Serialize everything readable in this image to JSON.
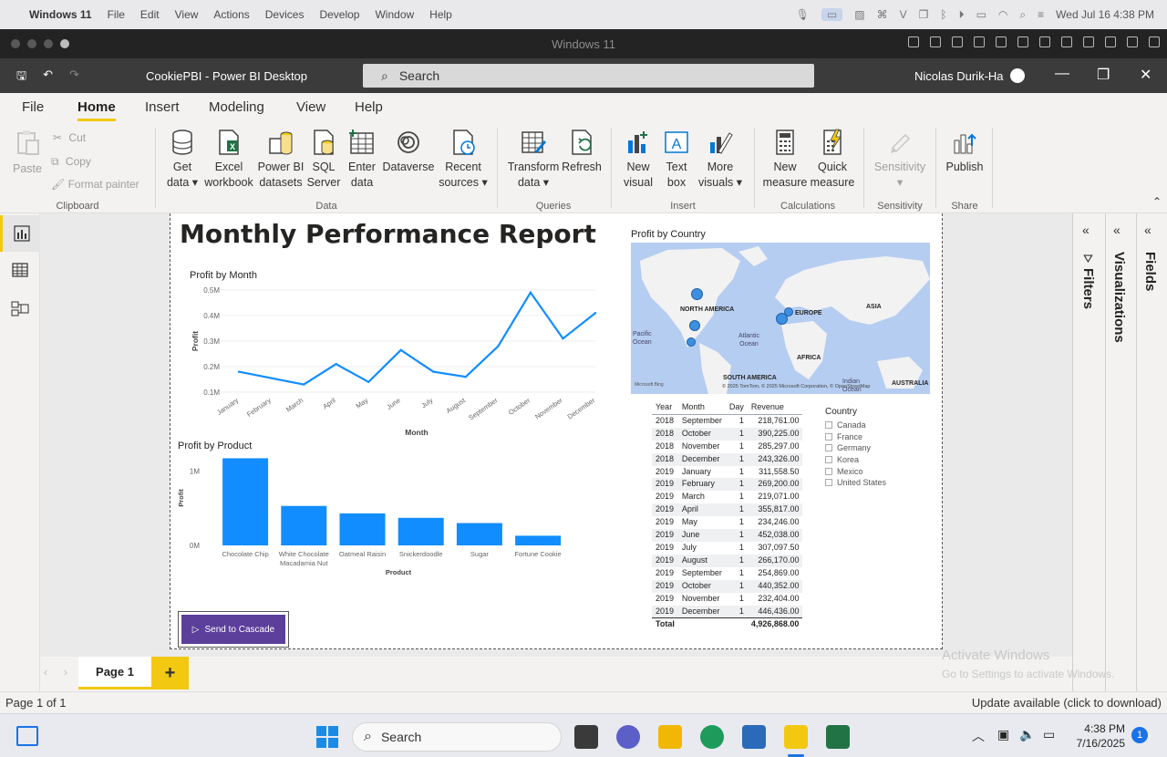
{
  "mac": {
    "menu": [
      "Windows 11",
      "File",
      "Edit",
      "View",
      "Actions",
      "Devices",
      "Develop",
      "Window",
      "Help"
    ],
    "datetime": "Wed Jul 16  4:38 PM"
  },
  "vm": {
    "title": "Windows 11"
  },
  "app": {
    "title": "CookiePBI - Power BI Desktop",
    "search_placeholder": "Search",
    "user": "Nicolas Durik-Ha"
  },
  "tabs": [
    "File",
    "Home",
    "Insert",
    "Modeling",
    "View",
    "Help"
  ],
  "ribbon": {
    "clipboard": {
      "paste": "Paste",
      "cut": "Cut",
      "copy": "Copy",
      "format_painter": "Format painter",
      "group": "Clipboard"
    },
    "data": {
      "get_data": [
        "Get",
        "data"
      ],
      "excel": [
        "Excel",
        "workbook"
      ],
      "pbi_datasets": [
        "Power BI",
        "datasets"
      ],
      "sql": [
        "SQL",
        "Server"
      ],
      "enter": [
        "Enter",
        "data"
      ],
      "dataverse": [
        "Dataverse",
        ""
      ],
      "recent": [
        "Recent",
        "sources"
      ],
      "group": "Data"
    },
    "queries": {
      "transform": [
        "Transform",
        "data"
      ],
      "refresh": [
        "Refresh",
        ""
      ],
      "group": "Queries"
    },
    "insert": {
      "new_visual": [
        "New",
        "visual"
      ],
      "text_box": [
        "Text",
        "box"
      ],
      "more_visuals": [
        "More",
        "visuals"
      ],
      "group": "Insert"
    },
    "calculations": {
      "new_measure": [
        "New",
        "measure"
      ],
      "quick_measure": [
        "Quick",
        "measure"
      ],
      "group": "Calculations"
    },
    "sensitivity": {
      "label": "Sensitivity",
      "group": "Sensitivity"
    },
    "share": {
      "publish": "Publish",
      "group": "Share"
    }
  },
  "report": {
    "title": "Monthly Performance Report",
    "send_button": "Send to Cascade",
    "map_title": "Profit by Country",
    "map_labels": {
      "na": "NORTH AMERICA",
      "europe": "EUROPE",
      "asia": "ASIA",
      "africa": "AFRICA",
      "sa": "SOUTH AMERICA",
      "australia": "AUSTRALIA",
      "pacific": "Pacific\nOcean",
      "atlantic": "Atlantic\nOcean",
      "indian": "Indian\nOcean",
      "attribution": "© 2025 TomTom, © 2025 Microsoft Corporation, © OpenStreetMap",
      "bing": "Microsoft Bing"
    },
    "slicer": {
      "title": "Country",
      "options": [
        "Canada",
        "France",
        "Germany",
        "Korea",
        "Mexico",
        "United States"
      ]
    },
    "table": {
      "headers": [
        "Year",
        "Month",
        "Day",
        "Revenue"
      ],
      "rows": [
        [
          "2018",
          "September",
          "1",
          "218,761.00"
        ],
        [
          "2018",
          "October",
          "1",
          "390,225.00"
        ],
        [
          "2018",
          "November",
          "1",
          "285,297.00"
        ],
        [
          "2018",
          "December",
          "1",
          "243,326.00"
        ],
        [
          "2019",
          "January",
          "1",
          "311,558.50"
        ],
        [
          "2019",
          "February",
          "1",
          "269,200.00"
        ],
        [
          "2019",
          "March",
          "1",
          "219,071.00"
        ],
        [
          "2019",
          "April",
          "1",
          "355,817.00"
        ],
        [
          "2019",
          "May",
          "1",
          "234,246.00"
        ],
        [
          "2019",
          "June",
          "1",
          "452,038.00"
        ],
        [
          "2019",
          "July",
          "1",
          "307,097.50"
        ],
        [
          "2019",
          "August",
          "1",
          "266,170.00"
        ],
        [
          "2019",
          "September",
          "1",
          "254,869.00"
        ],
        [
          "2019",
          "October",
          "1",
          "440,352.00"
        ],
        [
          "2019",
          "November",
          "1",
          "232,404.00"
        ],
        [
          "2019",
          "December",
          "1",
          "446,436.00"
        ]
      ],
      "total_label": "Total",
      "total_value": "4,926,868.00"
    }
  },
  "chart_data": [
    {
      "type": "line",
      "title": "Profit by Month",
      "xlabel": "Month",
      "ylabel": "Profit",
      "categories": [
        "January",
        "February",
        "March",
        "April",
        "May",
        "June",
        "July",
        "August",
        "September",
        "October",
        "November",
        "December"
      ],
      "values": [
        0.18,
        0.155,
        0.13,
        0.21,
        0.14,
        0.265,
        0.18,
        0.16,
        0.28,
        0.49,
        0.31,
        0.41
      ],
      "yticks": [
        "0.1M",
        "0.2M",
        "0.3M",
        "0.4M",
        "0.5M"
      ],
      "ylim": [
        0.1,
        0.5
      ],
      "color": "#118dff"
    },
    {
      "type": "bar",
      "title": "Profit by Product",
      "xlabel": "Product",
      "ylabel": "Profit",
      "categories": [
        "Chocolate Chip",
        "White Chocolate Macadamia Nut",
        "Oatmeal Raisin",
        "Snickerdoodle",
        "Sugar",
        "Fortune Cookie"
      ],
      "values": [
        1.17,
        0.53,
        0.43,
        0.37,
        0.3,
        0.13
      ],
      "yticks": [
        "0M",
        "1M"
      ],
      "ylim": [
        0,
        1.2
      ],
      "color": "#118dff"
    }
  ],
  "pages": {
    "page1": "Page 1"
  },
  "panes": {
    "filters": "Filters",
    "visualizations": "Visualizations",
    "fields": "Fields"
  },
  "activate": {
    "line1": "Activate Windows",
    "line2": "Go to Settings to activate Windows."
  },
  "status": {
    "left": "Page 1 of 1",
    "right": "Update available (click to download)"
  },
  "taskbar": {
    "search": "Search",
    "time": "4:38 PM",
    "date": "7/16/2025",
    "badge": "1"
  }
}
